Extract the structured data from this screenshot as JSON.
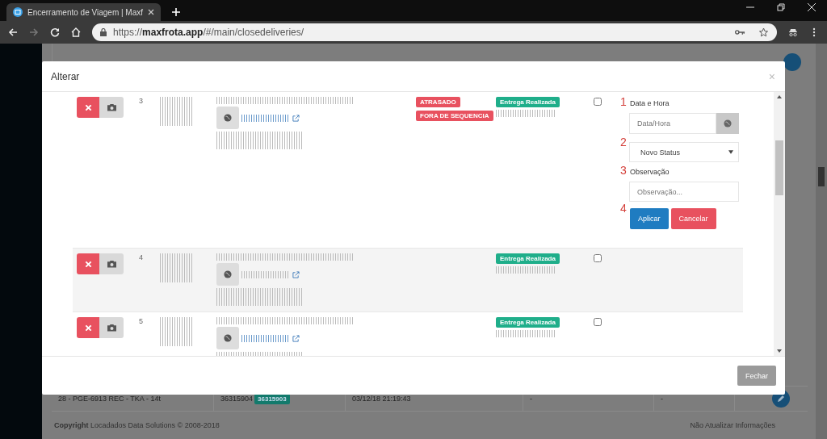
{
  "browser": {
    "tab_title": "Encerramento de Viagem | Maxf",
    "url_scheme": "https://",
    "url_host": "maxfrota.app",
    "url_path": "/#/main/closedeliveries/"
  },
  "modal": {
    "title": "Alterar",
    "close": "×",
    "rows": [
      {
        "number": "3",
        "tags": [
          {
            "label": "ATRASADO"
          },
          {
            "label": "FORA DE SEQUENCIA"
          }
        ],
        "status": "Entrega Realizada",
        "checked": false,
        "editing": true
      },
      {
        "number": "4",
        "tags": [],
        "status": "Entrega Realizada",
        "checked": false,
        "editing": false
      },
      {
        "number": "5",
        "tags": [],
        "status": "Entrega Realizada",
        "checked": false,
        "editing": false
      }
    ],
    "form": {
      "steps": [
        "1",
        "2",
        "3",
        "4"
      ],
      "datetime_label": "Data e Hora",
      "datetime_placeholder": "Data/Hora",
      "status_select": "Novo Status",
      "note_label": "Observação",
      "note_placeholder": "Observação...",
      "apply": "Aplicar",
      "cancel": "Cancelar"
    },
    "close_button": "Fechar"
  },
  "background": {
    "row": {
      "vehicle": "28 - PGE-6913 REC - TKA - 14t",
      "code": "36315904",
      "badge": "36315903",
      "datetime": "03/12/18 21:19:43",
      "column_5": "-",
      "column_6": "-"
    },
    "copyright_bold": "Copyright",
    "copyright": "Locadados Data Solutions © 2008-2018",
    "sync_link": "Não Atualizar Informações"
  }
}
